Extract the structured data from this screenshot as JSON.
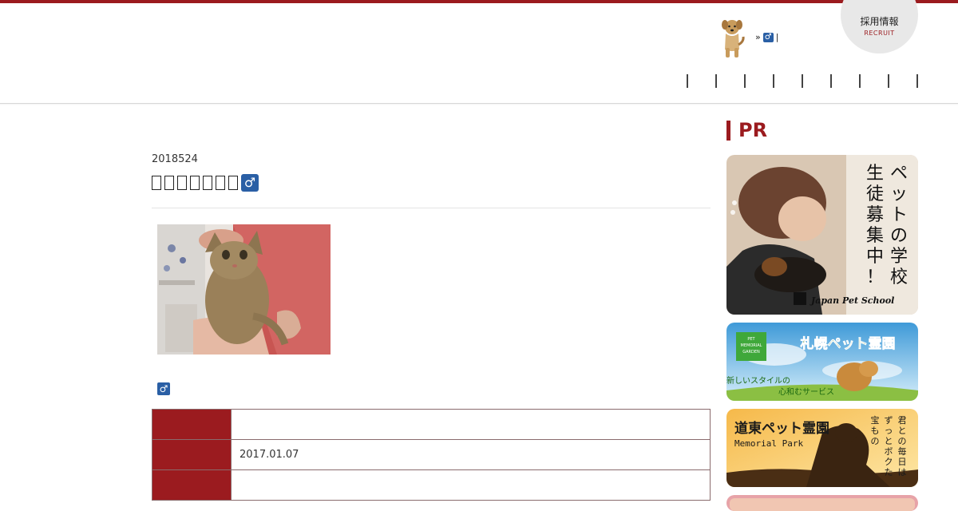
{
  "header": {
    "recruit_jp": "採用情報",
    "recruit_en": "RECRUIT",
    "breadcrumb_arrow": "»",
    "breadcrumb_badge": "♂",
    "breadcrumb_sep": "|"
  },
  "post": {
    "date": "2018524",
    "title_badge": "♂",
    "category_badge": "♂"
  },
  "table": {
    "rows": [
      {
        "value": ""
      },
      {
        "value": "2017.01.07"
      },
      {
        "value": ""
      }
    ]
  },
  "sidebar": {
    "pr_title": "PR",
    "ads": [
      {
        "lines": [
          "ペットの学校",
          "生徒募集中！"
        ],
        "brand": "Japan Pet School"
      },
      {
        "title": "札幌ペット霊園",
        "badge": [
          "PET",
          "MEMORIAL",
          "GARDEN"
        ],
        "tagline": [
          "新しいスタイルの",
          "心和むサービス"
        ]
      },
      {
        "title": "道東ペット霊園",
        "subtitle": "Memorial Park",
        "vertical": [
          "君との毎日は",
          "ずっとボクたちの",
          "宝もの"
        ]
      }
    ]
  },
  "colors": {
    "accent": "#9b1b1f",
    "badge": "#2a5fa5"
  }
}
